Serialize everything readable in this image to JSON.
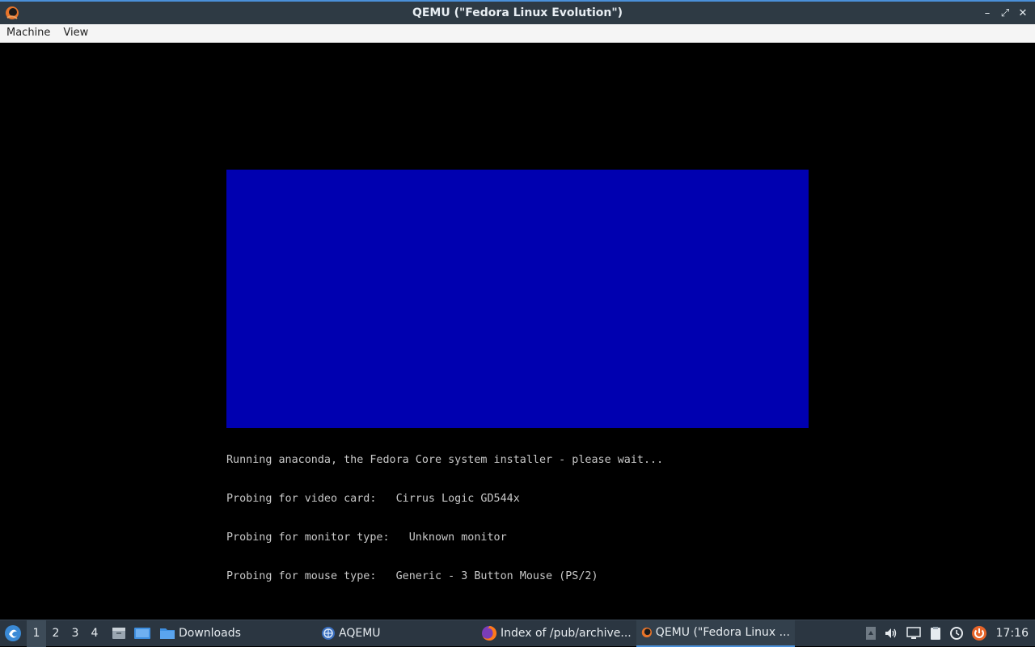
{
  "window": {
    "title": "QEMU (\"Fedora Linux Evolution\")",
    "minimize_glyph": "–",
    "maximize_glyph": "⤢",
    "close_glyph": "✕"
  },
  "menubar": {
    "items": [
      "Machine",
      "View"
    ]
  },
  "vm": {
    "blue_color": "#0000b0",
    "console_lines": [
      "Running anaconda, the Fedora Core system installer - please wait...",
      "Probing for video card:   Cirrus Logic GD544x",
      "Probing for monitor type:   Unknown monitor",
      "Probing for mouse type:   Generic - 3 Button Mouse (PS/2)"
    ]
  },
  "taskbar": {
    "desktops": [
      "1",
      "2",
      "3",
      "4"
    ],
    "active_desktop": "1",
    "tasks": [
      {
        "label": "Downloads",
        "icon": "folder-icon"
      },
      {
        "label": "AQEMU",
        "icon": "aqemu-icon"
      },
      {
        "label": "Index of /pub/archive...",
        "icon": "firefox-icon"
      },
      {
        "label": "QEMU (\"Fedora Linux ...",
        "icon": "qemu-icon"
      }
    ],
    "clock": "17:16"
  },
  "colors": {
    "accent": "#4a90d9",
    "panel": "#2b3641",
    "titlebar": "#2e3a44"
  }
}
